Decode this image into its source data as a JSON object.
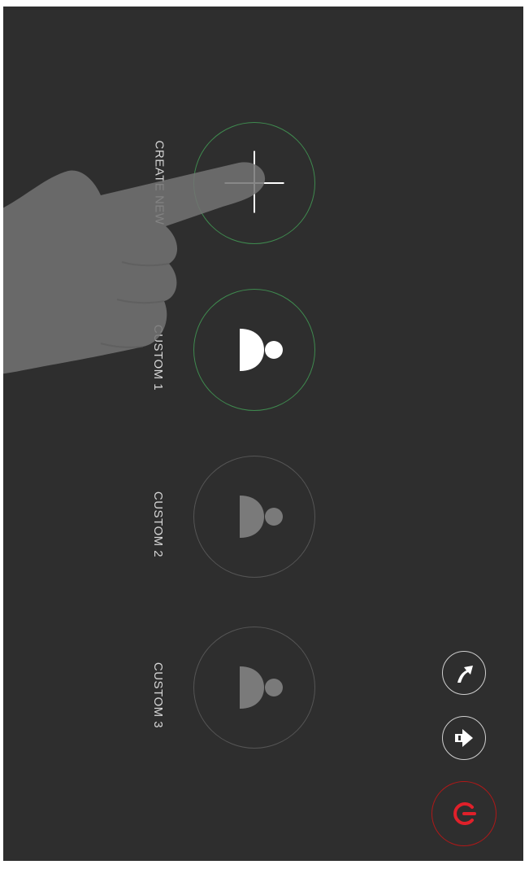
{
  "presets": [
    {
      "label": "CREATE NEW",
      "state": "active",
      "icon": "plus-icon"
    },
    {
      "label": "CUSTOM 1",
      "state": "active",
      "icon": "speaker-icon"
    },
    {
      "label": "CUSTOM 2",
      "state": "inactive",
      "icon": "speaker-icon"
    },
    {
      "label": "CUSTOM 3",
      "state": "inactive",
      "icon": "speaker-icon"
    }
  ],
  "controls": {
    "up_icon": "curved-arrow-up-icon",
    "next_icon": "arrow-right-icon",
    "power_icon": "power-icon"
  },
  "colors": {
    "background": "#2e2e2e",
    "active_ring": "#3f8a4f",
    "inactive_ring": "#555555",
    "power": "#e0202a",
    "text": "#d7d7d7"
  }
}
